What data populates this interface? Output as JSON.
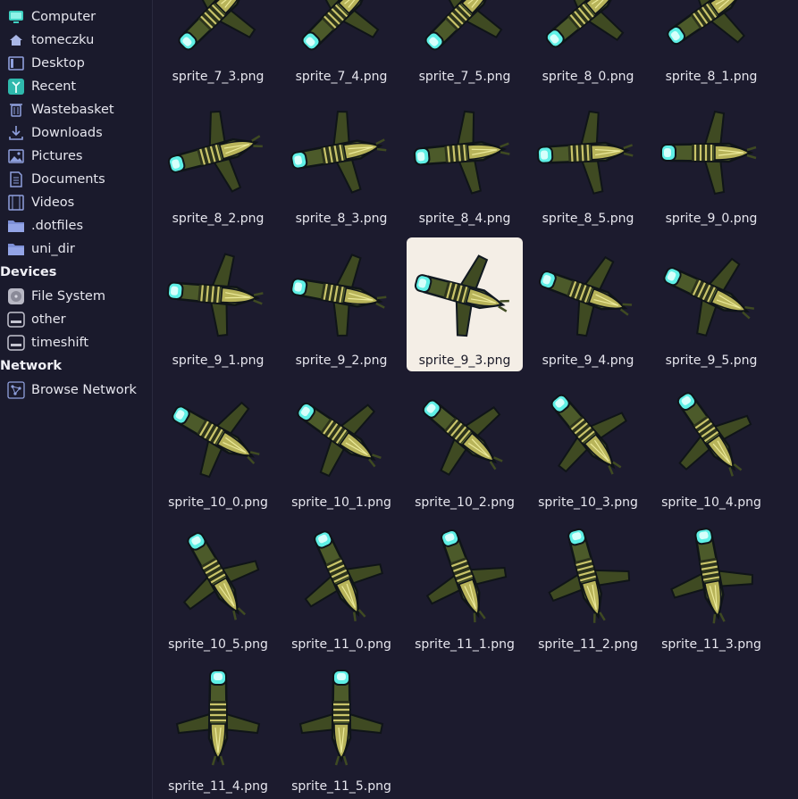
{
  "sidebar": {
    "places": [
      {
        "label": "Computer",
        "icon": "computer-icon"
      },
      {
        "label": "tomeczku",
        "icon": "home-icon"
      },
      {
        "label": "Desktop",
        "icon": "desktop-icon"
      },
      {
        "label": "Recent",
        "icon": "recent-icon"
      },
      {
        "label": "Wastebasket",
        "icon": "trash-icon"
      },
      {
        "label": "Downloads",
        "icon": "download-icon"
      },
      {
        "label": "Pictures",
        "icon": "pictures-icon"
      },
      {
        "label": "Documents",
        "icon": "documents-icon"
      },
      {
        "label": "Videos",
        "icon": "videos-icon"
      },
      {
        "label": ".dotfiles",
        "icon": "folder-icon"
      },
      {
        "label": "uni_dir",
        "icon": "folder-icon"
      }
    ],
    "devices_header": "Devices",
    "devices": [
      {
        "label": "File System",
        "icon": "filesystem-icon"
      },
      {
        "label": "other",
        "icon": "drive-icon"
      },
      {
        "label": "timeshift",
        "icon": "drive-icon"
      }
    ],
    "network_header": "Network",
    "network": [
      {
        "label": "Browse Network",
        "icon": "network-icon"
      }
    ]
  },
  "files": [
    "sprite_7_3.png",
    "sprite_7_4.png",
    "sprite_7_5.png",
    "sprite_8_0.png",
    "sprite_8_1.png",
    "sprite_8_2.png",
    "sprite_8_3.png",
    "sprite_8_4.png",
    "sprite_8_5.png",
    "sprite_9_0.png",
    "sprite_9_1.png",
    "sprite_9_2.png",
    "sprite_9_3.png",
    "sprite_9_4.png",
    "sprite_9_5.png",
    "sprite_10_0.png",
    "sprite_10_1.png",
    "sprite_10_2.png",
    "sprite_10_3.png",
    "sprite_10_4.png",
    "sprite_10_5.png",
    "sprite_11_0.png",
    "sprite_11_1.png",
    "sprite_11_2.png",
    "sprite_11_3.png",
    "sprite_11_4.png",
    "sprite_11_5.png"
  ],
  "selected_file": "sprite_9_3.png",
  "colors": {
    "background": "#1c1b2e",
    "selection": "#f4eee6",
    "thruster": "#5ff0e6",
    "hull": "#3f4a22",
    "accent": "#c9c46a"
  }
}
